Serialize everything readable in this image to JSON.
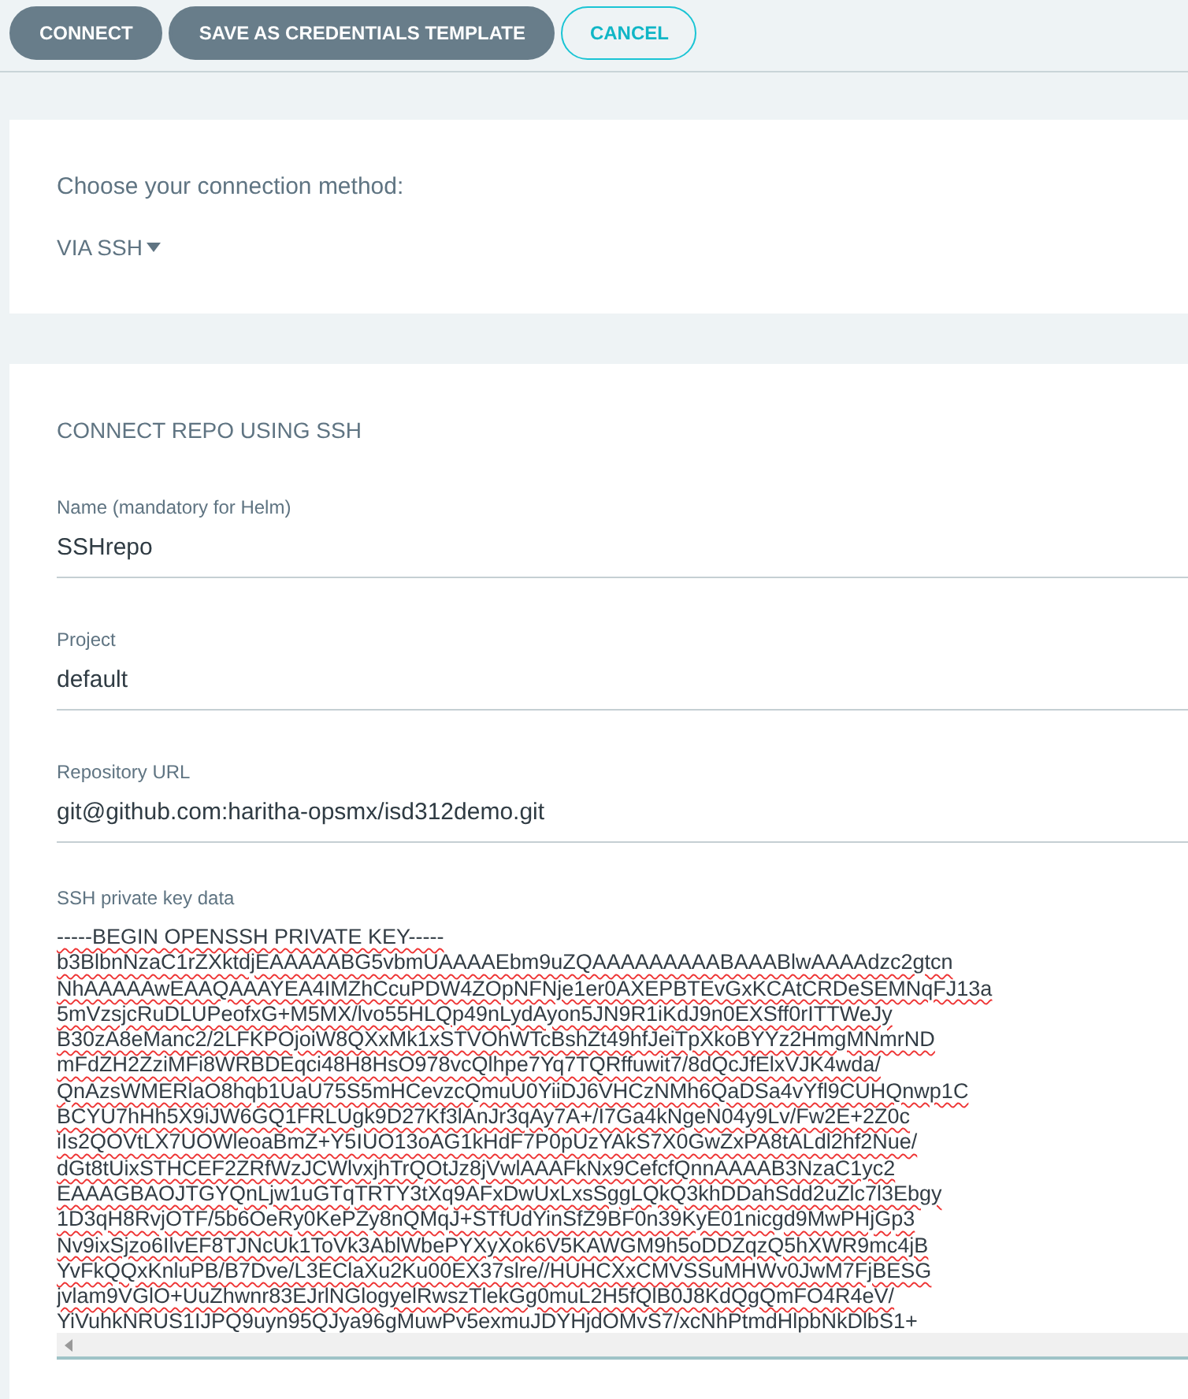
{
  "toolbar": {
    "buttons": [
      {
        "label": "CONNECT",
        "kind": "filled"
      },
      {
        "label": "SAVE AS CREDENTIALS TEMPLATE",
        "kind": "filled"
      },
      {
        "label": "CANCEL",
        "kind": "outline"
      }
    ]
  },
  "method": {
    "prompt": "Choose your connection method:",
    "value": "VIA SSH"
  },
  "form": {
    "title": "CONNECT REPO USING SSH",
    "fields": [
      {
        "label": "Name (mandatory for Helm)",
        "value": "SSHrepo"
      },
      {
        "label": "Project",
        "value": "default"
      },
      {
        "label": "Repository URL",
        "value": "git@github.com:haritha-opsmx/isd312demo.git"
      }
    ],
    "ssh_key": {
      "label": "SSH private key data",
      "lines": [
        "-----BEGIN OPENSSH PRIVATE KEY-----",
        "b3BlbnNzaC1rZXktdjEAAAAABG5vbmUAAAAEbm9uZQAAAAAAAAABAAABlwAAAAdzc2gtcn",
        "NhAAAAAwEAAQAAAYEA4IMZhCcuPDW4ZOpNFNje1er0AXEPBTEvGxKCAtCRDeSEMNqFJ13a",
        "5mVzsjcRuDLUPeofxG+M5MX/lvo55HLQp49nLydAyon5JN9R1iKdJ9n0EXSff0rITTWeJy",
        "B30zA8eManc2/2LFKPOjoiW8QXxMk1xSTVOhWTcBshZt49hfJeiTpXkoBYYz2HmgMNmrND",
        "mFdZH2ZziMFi8WRBDEqci48H8HsO978vcQlhpe7Yq7TQRffuwit7/8dQcJfElxVJK4wda/",
        "QnAzsWMERlaO8hqb1UaU75S5mHCevzcQmuU0YiiDJ6VHCzNMh6QaDSa4vYfl9CUHQnwp1C",
        "BCYU7hHh5X9iJW6GQ1FRLUgk9D27Kf3lAnJr3qAy7A+/I7Ga4kNgeN04y9Lv/Fw2E+2Z0c",
        "iIs2QOVtLX7UOWleoaBmZ+Y5IUO13oAG1kHdF7P0pUzYAkS7X0GwZxPA8tALdl2hf2Nue/",
        "dGt8tUixSTHCEF2ZRfWzJCWlvxjhTrQOtJz8jVwlAAAFkNx9CefcfQnnAAAAB3NzaC1yc2",
        "EAAAGBAOJTGYQnLjw1uGTqTRTY3tXq9AFxDwUxLxsSggLQkQ3khDDahSdd2uZlc7l3Ebgy",
        "1D3qH8RvjOTF/5b6OeRy0KePZy8nQMqJ+STfUdYinSfZ9BF0n39KyE01nicgd9MwPHjGp3",
        "Nv9ixSjzo6IlvEF8TJNcUk1ToVk3AblWbePYXyXok6V5KAWGM9h5oDDZqzQ5hXWR9mc4jB",
        "YvFkQQxKnluPB/B7Dve/L3EClaXu2Ku00EX37slre//HUHCXxCMVSSuMHWv0JwM7FjBESG",
        "jvlam9VGlO+UuZhwnr83EJrlNGlogyelRwszTlekGg0muL2H5fQlB0J8KdQgQmFO4R4eV/",
        "YiVuhkNRUS1IJPQ9uyn95QJya96gMuwPv5exmuJDYHjdOMvS7/xcNhPtmdHlpbNkDlbS1+"
      ]
    }
  }
}
